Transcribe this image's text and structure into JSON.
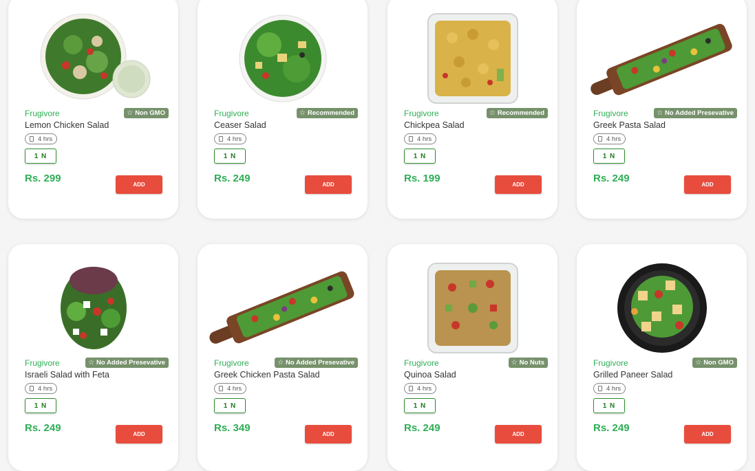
{
  "colors": {
    "background": "#f5f5f5",
    "brand_green": "#2fae55",
    "badge_bg": "#76916b",
    "add_button": "#e84c3d",
    "qty_border": "#2c8d2c"
  },
  "products": [
    {
      "brand": "Frugivore",
      "badge": "Non GMO",
      "name": "Lemon Chicken Salad",
      "time": "4 hrs",
      "qty": "1 N",
      "price": "Rs. 299",
      "add": "ADD",
      "image": "bowl-with-dip"
    },
    {
      "brand": "Frugivore",
      "badge": "Recommended",
      "name": "Ceaser Salad",
      "time": "4 hrs",
      "qty": "1 N",
      "price": "Rs. 249",
      "add": "ADD",
      "image": "round-bowl"
    },
    {
      "brand": "Frugivore",
      "badge": "Recommended",
      "name": "Chickpea Salad",
      "time": "4 hrs",
      "qty": "1 N",
      "price": "Rs. 199",
      "add": "ADD",
      "image": "square-box-chickpea"
    },
    {
      "brand": "Frugivore",
      "badge": "No Added Presevative",
      "name": "Greek Pasta Salad",
      "time": "4 hrs",
      "qty": "1 N",
      "price": "Rs. 249",
      "add": "ADD",
      "image": "wooden-board"
    },
    {
      "brand": "Frugivore",
      "badge": "No Added Presevative",
      "name": "Israeli Salad with Feta",
      "time": "4 hrs",
      "qty": "1 N",
      "price": "Rs. 249",
      "add": "ADD",
      "image": "leafy-heap"
    },
    {
      "brand": "Frugivore",
      "badge": "No Added Presevative",
      "name": "Greek Chicken Pasta Salad",
      "time": "4 hrs",
      "qty": "1 N",
      "price": "Rs. 349",
      "add": "ADD",
      "image": "wooden-board"
    },
    {
      "brand": "Frugivore",
      "badge": "No Nuts",
      "name": "Quinoa Salad",
      "time": "4 hrs",
      "qty": "1 N",
      "price": "Rs. 249",
      "add": "ADD",
      "image": "square-box-quinoa"
    },
    {
      "brand": "Frugivore",
      "badge": "Non GMO",
      "name": "Grilled Paneer Salad",
      "time": "4 hrs",
      "qty": "1 N",
      "price": "Rs. 249",
      "add": "ADD",
      "image": "black-bowl"
    }
  ]
}
